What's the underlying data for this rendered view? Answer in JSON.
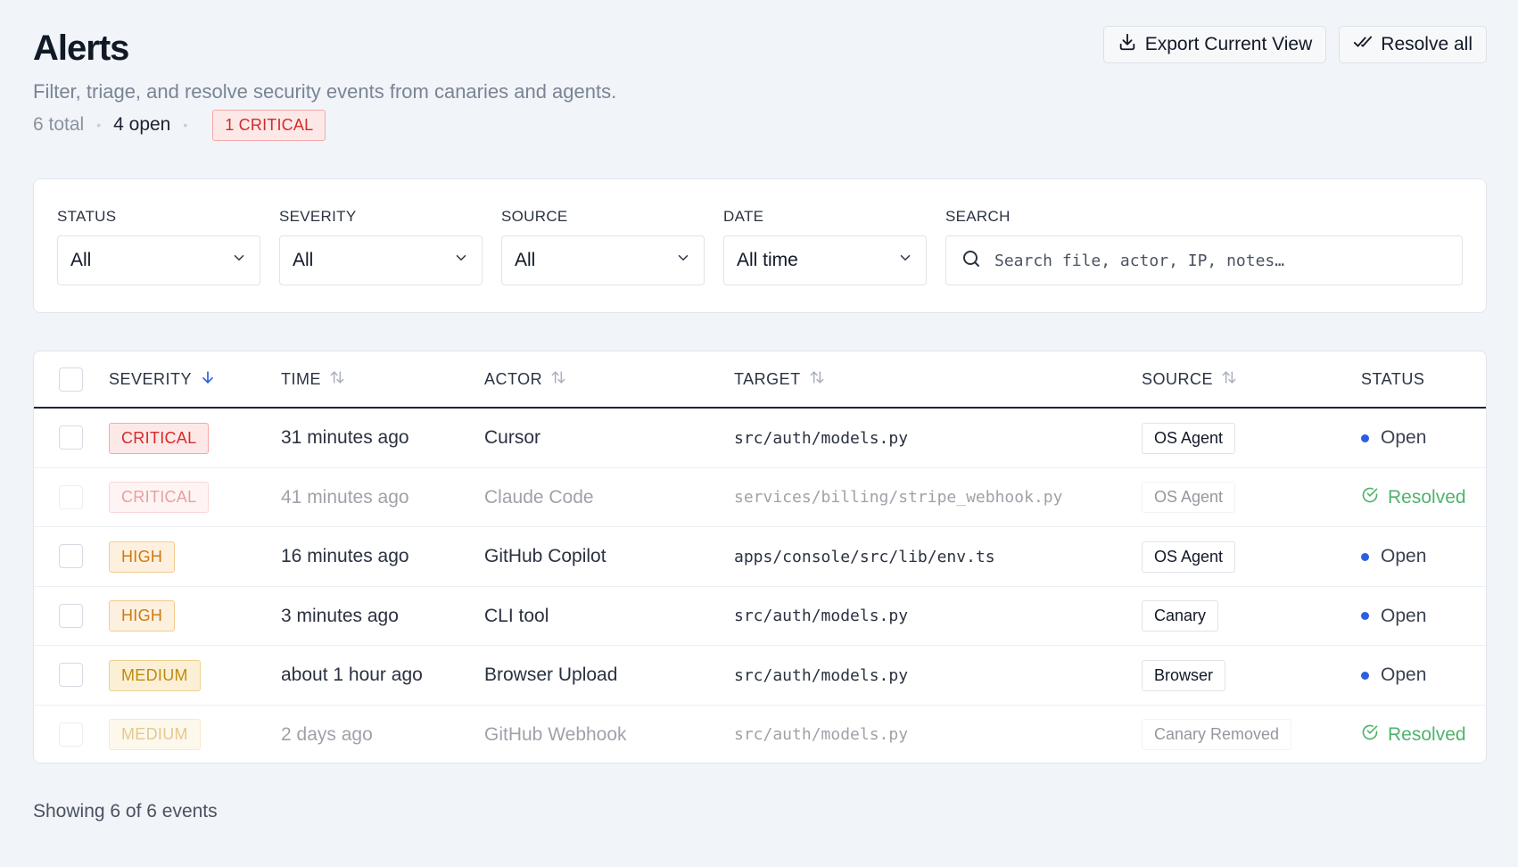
{
  "header": {
    "title": "Alerts",
    "subtitle": "Filter, triage, and resolve security events from canaries and agents.",
    "stats": {
      "total": "6 total",
      "open": "4 open",
      "critical": "1 CRITICAL"
    },
    "actions": {
      "export_label": "Export Current View",
      "resolve_label": "Resolve all"
    }
  },
  "filters": {
    "status": {
      "label": "STATUS",
      "value": "All"
    },
    "severity": {
      "label": "SEVERITY",
      "value": "All"
    },
    "source": {
      "label": "SOURCE",
      "value": "All"
    },
    "date": {
      "label": "DATE",
      "value": "All time"
    },
    "search": {
      "label": "SEARCH",
      "placeholder": "Search file, actor, IP, notes…"
    }
  },
  "table": {
    "columns": {
      "severity": "SEVERITY",
      "time": "TIME",
      "actor": "ACTOR",
      "target": "TARGET",
      "source": "SOURCE",
      "status": "STATUS"
    },
    "rows": [
      {
        "severity": "CRITICAL",
        "time": "31 minutes ago",
        "actor": "Cursor",
        "target": "src/auth/models.py",
        "source": "OS Agent",
        "status": "Open"
      },
      {
        "severity": "CRITICAL",
        "time": "41 minutes ago",
        "actor": "Claude Code",
        "target": "services/billing/stripe_webhook.py",
        "source": "OS Agent",
        "status": "Resolved"
      },
      {
        "severity": "HIGH",
        "time": "16 minutes ago",
        "actor": "GitHub Copilot",
        "target": "apps/console/src/lib/env.ts",
        "source": "OS Agent",
        "status": "Open"
      },
      {
        "severity": "HIGH",
        "time": "3 minutes ago",
        "actor": "CLI tool",
        "target": "src/auth/models.py",
        "source": "Canary",
        "status": "Open"
      },
      {
        "severity": "MEDIUM",
        "time": "about 1 hour ago",
        "actor": "Browser Upload",
        "target": "src/auth/models.py",
        "source": "Browser",
        "status": "Open"
      },
      {
        "severity": "MEDIUM",
        "time": "2 days ago",
        "actor": "GitHub Webhook",
        "target": "src/auth/models.py",
        "source": "Canary Removed",
        "status": "Resolved"
      }
    ]
  },
  "footer": {
    "text": "Showing 6 of 6 events"
  },
  "colors": {
    "critical": "#d52a2a",
    "high": "#cc7a12",
    "medium": "#c08a0c",
    "open_dot": "#2a5fe0",
    "resolved": "#4fb36c",
    "sort_active": "#2a5fe0"
  },
  "icons": {
    "export": "download-icon",
    "resolve": "double-check-icon",
    "dropdown": "chevron-down-icon",
    "search": "search-icon",
    "sort_desc": "arrow-down-icon",
    "sort": "sort-arrows-icon",
    "resolved": "check-circle-icon"
  }
}
